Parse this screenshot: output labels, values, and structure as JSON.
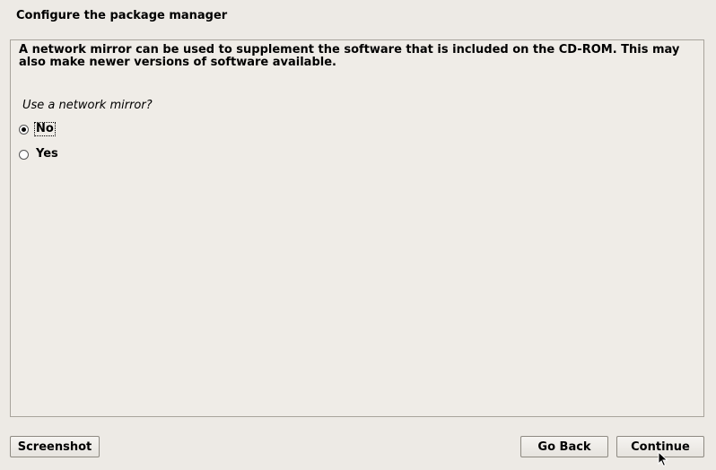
{
  "window": {
    "title": "Configure the package manager"
  },
  "panel": {
    "description": "A network mirror can be used to supplement the software that is included on the CD-ROM. This may also make newer versions of software available.",
    "question": "Use a network mirror?",
    "options": [
      {
        "label": "No",
        "selected": true
      },
      {
        "label": "Yes",
        "selected": false
      }
    ]
  },
  "buttons": {
    "screenshot": "Screenshot",
    "go_back": "Go Back",
    "continue": "Continue"
  },
  "icons": {
    "cursor": "mouse-pointer-icon"
  }
}
